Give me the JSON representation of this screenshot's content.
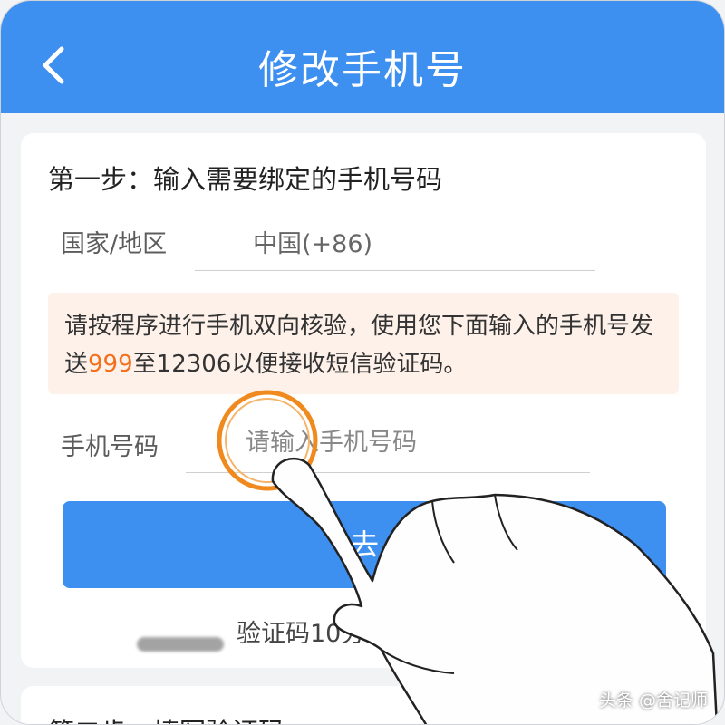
{
  "header": {
    "title": "修改手机号",
    "back_icon": "chevron-left-icon"
  },
  "step1": {
    "title": "第一步：输入需要绑定的手机号码",
    "country_label": "国家/地区",
    "country_value": "中国(+86)",
    "notice_before": "请按程序进行手机双向核验，使用您下面输入的手机号发送",
    "notice_highlight": "999",
    "notice_after": "至12306以便接收短信验证码。",
    "phone_label": "手机号码",
    "phone_placeholder": "请输入手机号码",
    "button_label": "去",
    "note": "验证码10分钟内"
  },
  "step2": {
    "title": "第二步：填写验证码"
  },
  "watermark": "头条 @舍记师",
  "colors": {
    "brand": "#3d8ff0",
    "highlight": "#f36f1c",
    "notice_bg": "#fdf1ea",
    "ring": "#f08a1e"
  }
}
